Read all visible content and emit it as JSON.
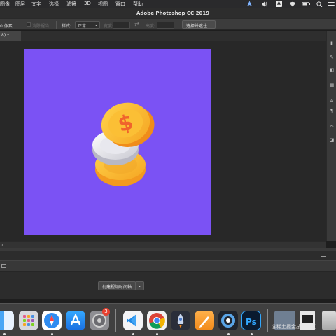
{
  "menubar": {
    "items": [
      "图像",
      "图层",
      "文字",
      "选择",
      "滤镜",
      "3D",
      "视图",
      "窗口",
      "帮助"
    ],
    "status_a": "A"
  },
  "title": "Adobe Photoshop CC 2019",
  "options_bar": {
    "feather_value": "0 像素",
    "antialias_label": "消除锯齿",
    "style_label": "样式:",
    "style_value": "正常",
    "width_label": "宽度:",
    "height_label": "高度:",
    "select_mask_button": "选择并遮住..."
  },
  "document_tab": {
    "label": "8) *"
  },
  "canvas": {
    "background_color": "#7b52f4"
  },
  "timeline": {
    "create_video_label": "创建视频时间轴",
    "dropdown_icon": "chevron-down-icon"
  },
  "dock": {
    "badge_count": "3",
    "apps": [
      "finder",
      "launchpad",
      "safari",
      "app-store",
      "system-preferences",
      "vscode",
      "chrome",
      "rocket",
      "pencil",
      "cinema4d",
      "photoshop"
    ]
  },
  "watermark": "@稀土掘金技术社区"
}
